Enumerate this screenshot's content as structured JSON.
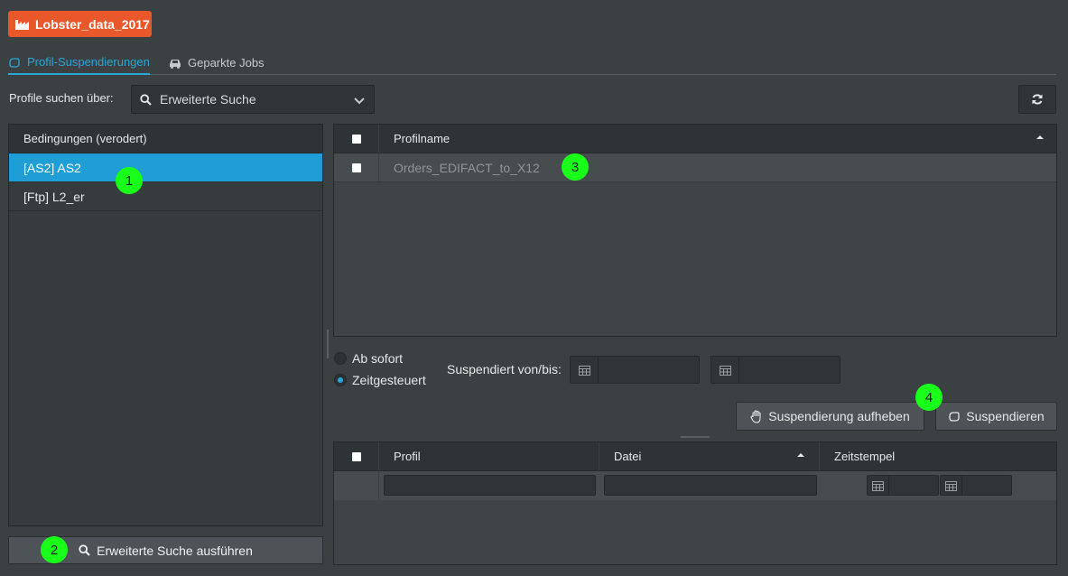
{
  "app": {
    "title": "Lobster_data_2017",
    "icon": "factory-icon"
  },
  "tabs": [
    {
      "label": "Profil-Suspendierungen",
      "icon": "hand-icon",
      "active": true
    },
    {
      "label": "Geparkte Jobs",
      "icon": "car-icon",
      "active": false
    }
  ],
  "search": {
    "label": "Profile suchen über:",
    "selected": "Erweiterte Suche",
    "icon": "search-icon",
    "refresh_icon": "refresh-icon"
  },
  "conditions": {
    "header": "Bedingungen (verodert)",
    "items": [
      {
        "label": "[AS2] AS2",
        "selected": true
      },
      {
        "label": "[Ftp] L2_er",
        "selected": false
      }
    ],
    "run_button": "Erweiterte Suche ausführen"
  },
  "profile_table": {
    "column": "Profilname",
    "rows": [
      "Orders_EDIFACT_to_X12"
    ]
  },
  "schedule": {
    "option_immediate": "Ab sofort",
    "option_timed": "Zeitgesteuert",
    "selected": "Zeitgesteuert",
    "range_label": "Suspendiert von/bis:",
    "from_value": "",
    "to_value": ""
  },
  "actions": {
    "unsuspend": "Suspendierung aufheben",
    "suspend": "Suspendieren"
  },
  "jobs_table": {
    "columns": [
      "Profil",
      "Datei",
      "Zeitstempel"
    ],
    "sorted_column": "Datei",
    "filters": {
      "profil": "",
      "datei": "",
      "from": "",
      "to": ""
    }
  },
  "markers": [
    "1",
    "2",
    "3",
    "4"
  ],
  "colors": {
    "accent": "#29a7d9",
    "badge": "#e8582a",
    "selected_row": "#1f9ed6",
    "marker": "#1aff1a"
  }
}
